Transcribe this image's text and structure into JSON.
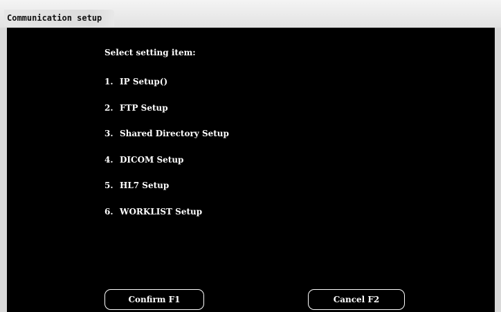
{
  "window": {
    "title": "Communication setup"
  },
  "menu": {
    "heading": "Select setting item:",
    "items": [
      {
        "number": "1.",
        "label": "IP Setup()"
      },
      {
        "number": "2.",
        "label": "FTP Setup"
      },
      {
        "number": "3.",
        "label": "Shared Directory Setup"
      },
      {
        "number": "4.",
        "label": "DICOM Setup"
      },
      {
        "number": "5.",
        "label": "HL7 Setup"
      },
      {
        "number": "6.",
        "label": "WORKLIST Setup"
      }
    ]
  },
  "buttons": {
    "confirm_label": "Confirm F1",
    "cancel_label": "Cancel F2"
  },
  "colors": {
    "panel_background": "#000000",
    "text": "#ffffff",
    "titlebar": "#e4e4e4"
  }
}
